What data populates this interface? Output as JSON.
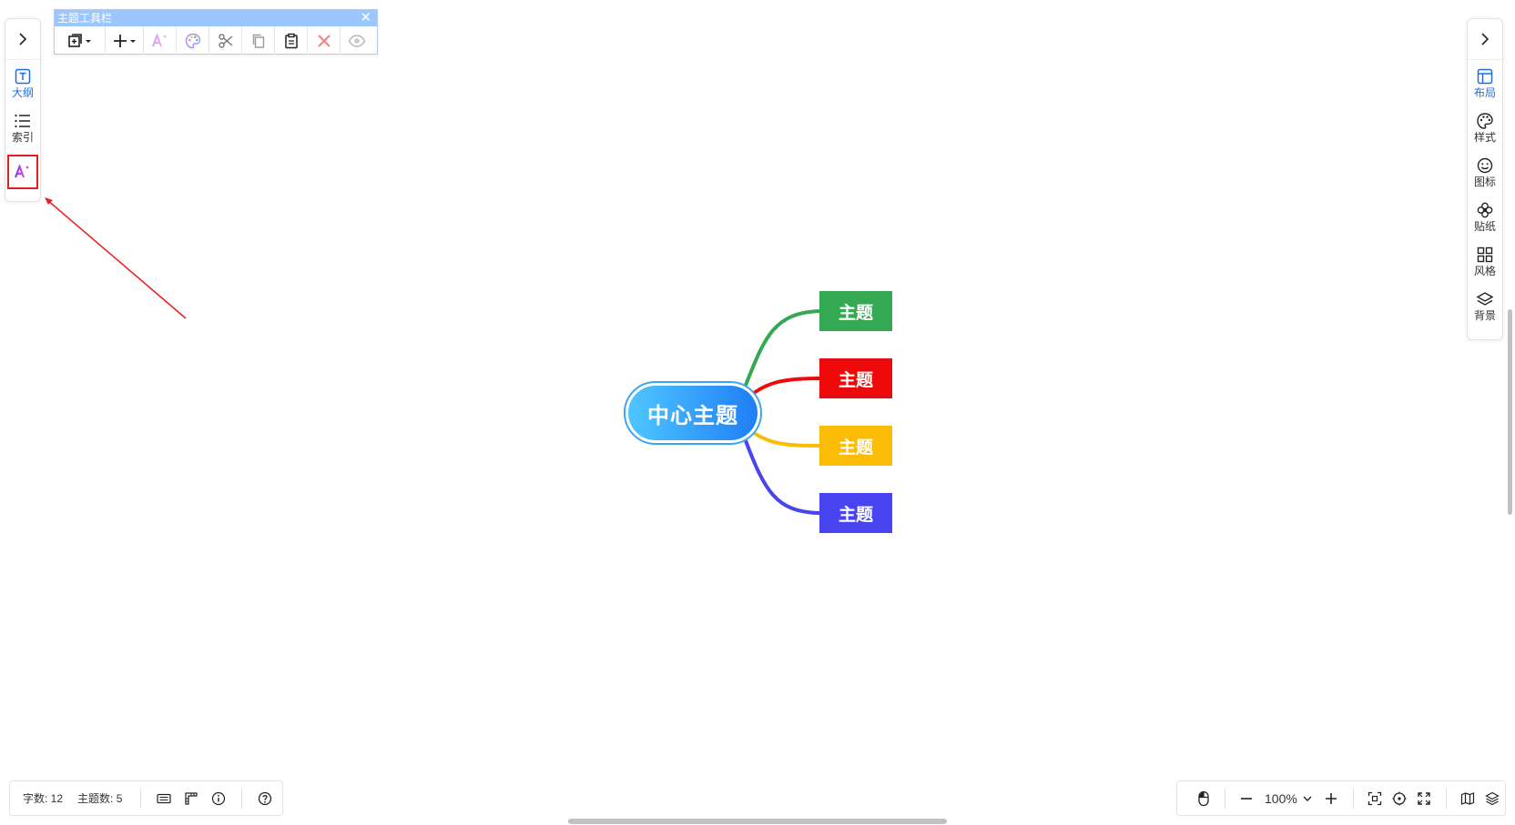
{
  "toolbar": {
    "title": "主题工具栏",
    "close_glyph": "✕",
    "buttons": [
      "add-child",
      "add-node",
      "ai",
      "palette",
      "cut",
      "copy",
      "paste",
      "delete",
      "preview"
    ]
  },
  "left_sidebar": {
    "items": [
      {
        "label": "大纲",
        "icon": "outline-icon"
      },
      {
        "label": "索引",
        "icon": "list-icon"
      },
      {
        "label": "",
        "icon": "ai-icon"
      }
    ]
  },
  "right_sidebar": {
    "items": [
      {
        "label": "布局",
        "icon": "layout-icon"
      },
      {
        "label": "样式",
        "icon": "palette-icon"
      },
      {
        "label": "图标",
        "icon": "smile-icon"
      },
      {
        "label": "贴纸",
        "icon": "flower-icon"
      },
      {
        "label": "风格",
        "icon": "grid-icon"
      },
      {
        "label": "背景",
        "icon": "layers-icon"
      }
    ]
  },
  "mindmap": {
    "center": "中心主题",
    "topics": [
      {
        "label": "主题",
        "color": "#34a853"
      },
      {
        "label": "主题",
        "color": "#ee0a0a"
      },
      {
        "label": "主题",
        "color": "#fbbc05"
      },
      {
        "label": "主题",
        "color": "#4845f0"
      }
    ]
  },
  "status": {
    "word_count": "字数: 12",
    "topic_count": "主题数: 5"
  },
  "zoom": {
    "level": "100%"
  },
  "colors": {
    "accent": "#1f6fe0",
    "highlight_box": "#e02020",
    "arrow": "#ee1c1c"
  }
}
